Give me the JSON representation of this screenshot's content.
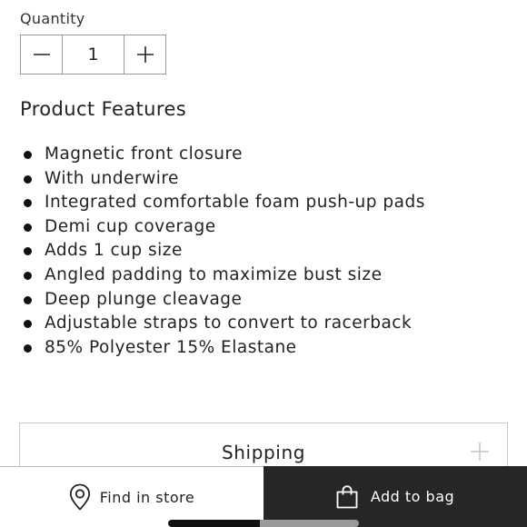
{
  "quantity": {
    "label": "Quantity",
    "value": "1",
    "decrement_icon": "minus-icon",
    "increment_icon": "plus-icon"
  },
  "features": {
    "title": "Product Features",
    "items": [
      "Magnetic front closure",
      "With underwire",
      "Integrated comfortable foam push-up pads",
      "Demi cup coverage",
      "Adds 1 cup size",
      "Angled padding to maximize bust size",
      "Deep plunge cleavage",
      "Adjustable straps to convert to racerback",
      "85% Polyester 15% Elastane"
    ]
  },
  "shipping": {
    "label": "Shipping",
    "toggle_icon": "plus-icon"
  },
  "bottom_bar": {
    "find_in_store": {
      "label": "Find in store",
      "icon": "location-pin-icon"
    },
    "add_to_bag": {
      "label": "Add to bag",
      "icon": "shopping-bag-icon"
    }
  },
  "colors": {
    "primary_dark": "#262626",
    "border": "#9a9a9a",
    "text": "#222222"
  }
}
